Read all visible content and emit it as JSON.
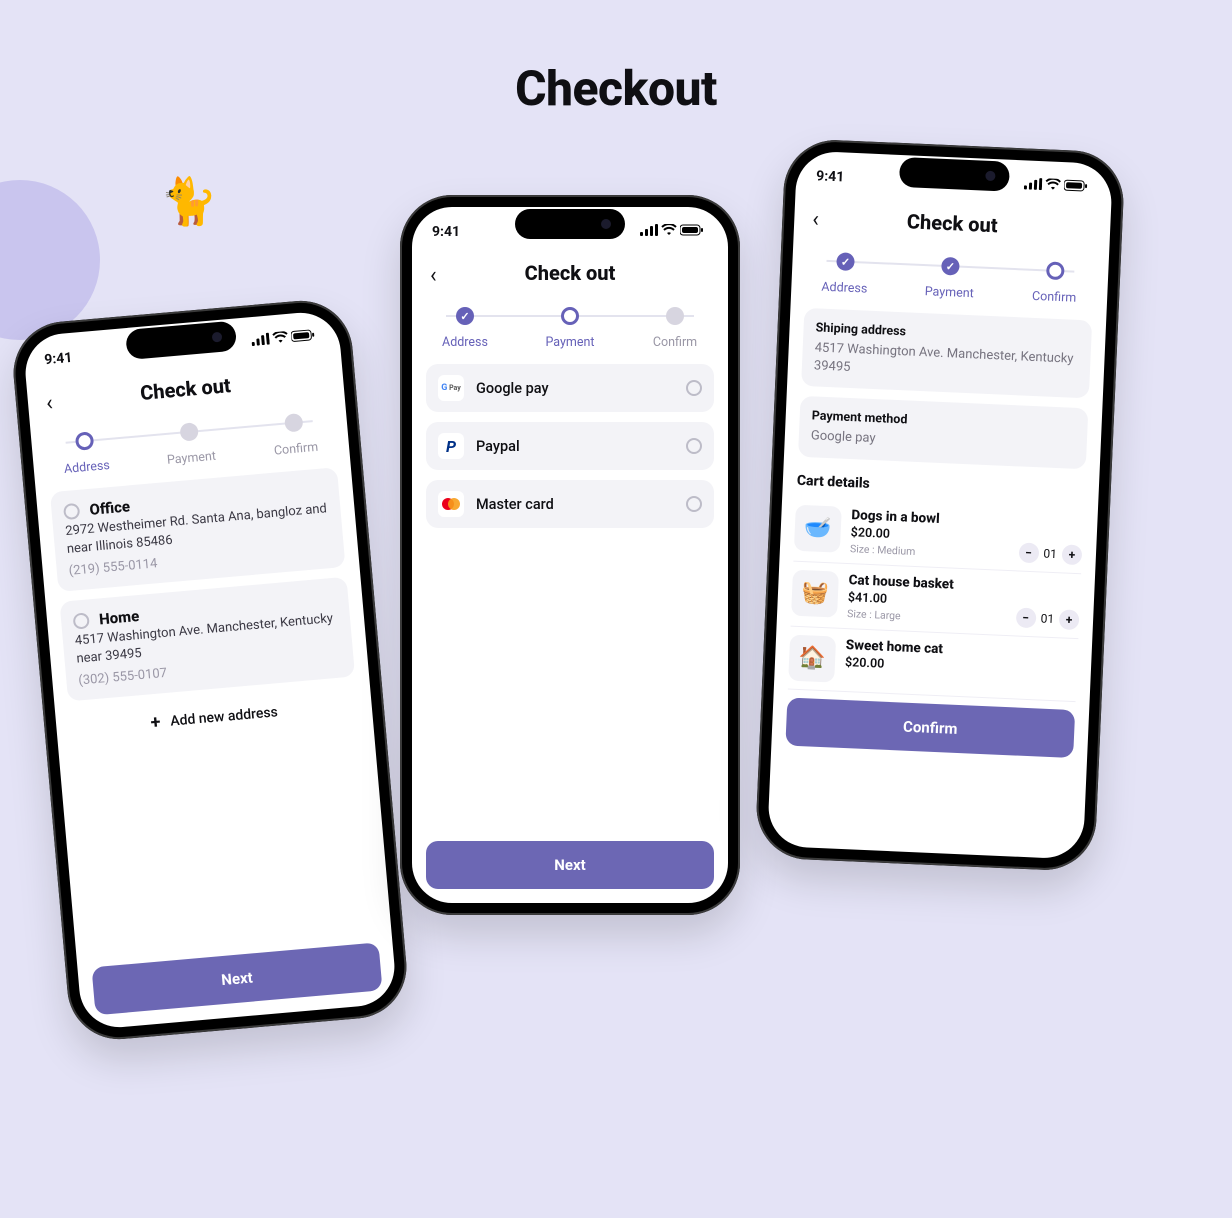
{
  "page_title": "Checkout",
  "status_time": "9:41",
  "screens": {
    "address": {
      "title": "Check out",
      "steps": [
        "Address",
        "Payment",
        "Confirm"
      ],
      "addresses": [
        {
          "name": "Office",
          "body": "2972 Westheimer Rd. Santa Ana, bangloz and near Illinois 85486",
          "phone": "(219) 555-0114"
        },
        {
          "name": "Home",
          "body": "4517 Washington Ave. Manchester, Kentucky near 39495",
          "phone": "(302) 555-0107"
        }
      ],
      "add_label": "Add new address",
      "cta": "Next"
    },
    "payment": {
      "title": "Check out",
      "steps": [
        "Address",
        "Payment",
        "Confirm"
      ],
      "methods": [
        {
          "label": "Google pay",
          "icon_text": "G Pay"
        },
        {
          "label": "Paypal",
          "icon_text": "P"
        },
        {
          "label": "Master card",
          "icon_text": "MC"
        }
      ],
      "cta": "Next"
    },
    "confirm": {
      "title": "Check out",
      "steps": [
        "Address",
        "Payment",
        "Confirm"
      ],
      "ship_head": "Shiping address",
      "ship_body": "4517 Washington Ave. Manchester, Kentucky 39495",
      "pm_head": "Payment method",
      "pm_body": "Google pay",
      "cart_head": "Cart details",
      "items": [
        {
          "name": "Dogs in a bowl",
          "price": "$20.00",
          "size": "Size : Medium",
          "qty": "01"
        },
        {
          "name": "Cat house basket",
          "price": "$41.00",
          "size": "Size : Large",
          "qty": "01"
        },
        {
          "name": "Sweet home cat",
          "price": "$20.00",
          "size": "",
          "qty": ""
        }
      ],
      "cta": "Confirm"
    }
  }
}
